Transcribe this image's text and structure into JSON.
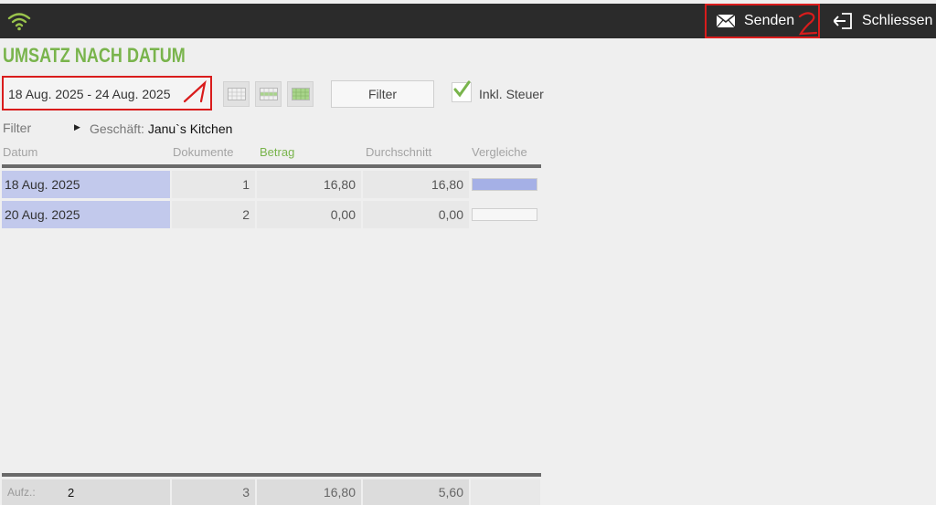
{
  "topbar": {
    "send_label": "Senden",
    "close_label": "Schliessen",
    "annotation_2": "2",
    "icons": [
      "wifi-icon",
      "mail-icon",
      "exit-icon"
    ]
  },
  "page": {
    "title": "UMSATZ NACH DATUM"
  },
  "toolbar": {
    "date_range": "18 Aug. 2025 - 24 Aug. 2025",
    "annotation_1": "1",
    "filter_button": "Filter",
    "tax_label": "Inkl. Steuer",
    "tax_checked": true
  },
  "filter": {
    "label": "Filter",
    "shop_key": "Geschäft:",
    "shop_value": "Janu`s Kitchen"
  },
  "table": {
    "columns": [
      "Datum",
      "Dokumente",
      "Betrag",
      "Durchschnitt",
      "Vergleiche"
    ],
    "active_column": "Betrag",
    "rows": [
      {
        "date": "18 Aug. 2025",
        "documents": "1",
        "amount": "16,80",
        "average": "16,80",
        "compare": 1.0
      },
      {
        "date": "20 Aug. 2025",
        "documents": "2",
        "amount": "0,00",
        "average": "0,00",
        "compare": 0.0
      }
    ],
    "footer": {
      "label": "Aufz.:",
      "count": "2",
      "documents": "3",
      "amount": "16,80",
      "average": "5,60"
    }
  },
  "colors": {
    "accent_green": "#79b44c",
    "topbar_bg": "#2b2b2b",
    "annotation_red": "#d91c1c",
    "date_cell_bg": "#c2c9ec",
    "compare_fill": "#a5b0e6"
  }
}
